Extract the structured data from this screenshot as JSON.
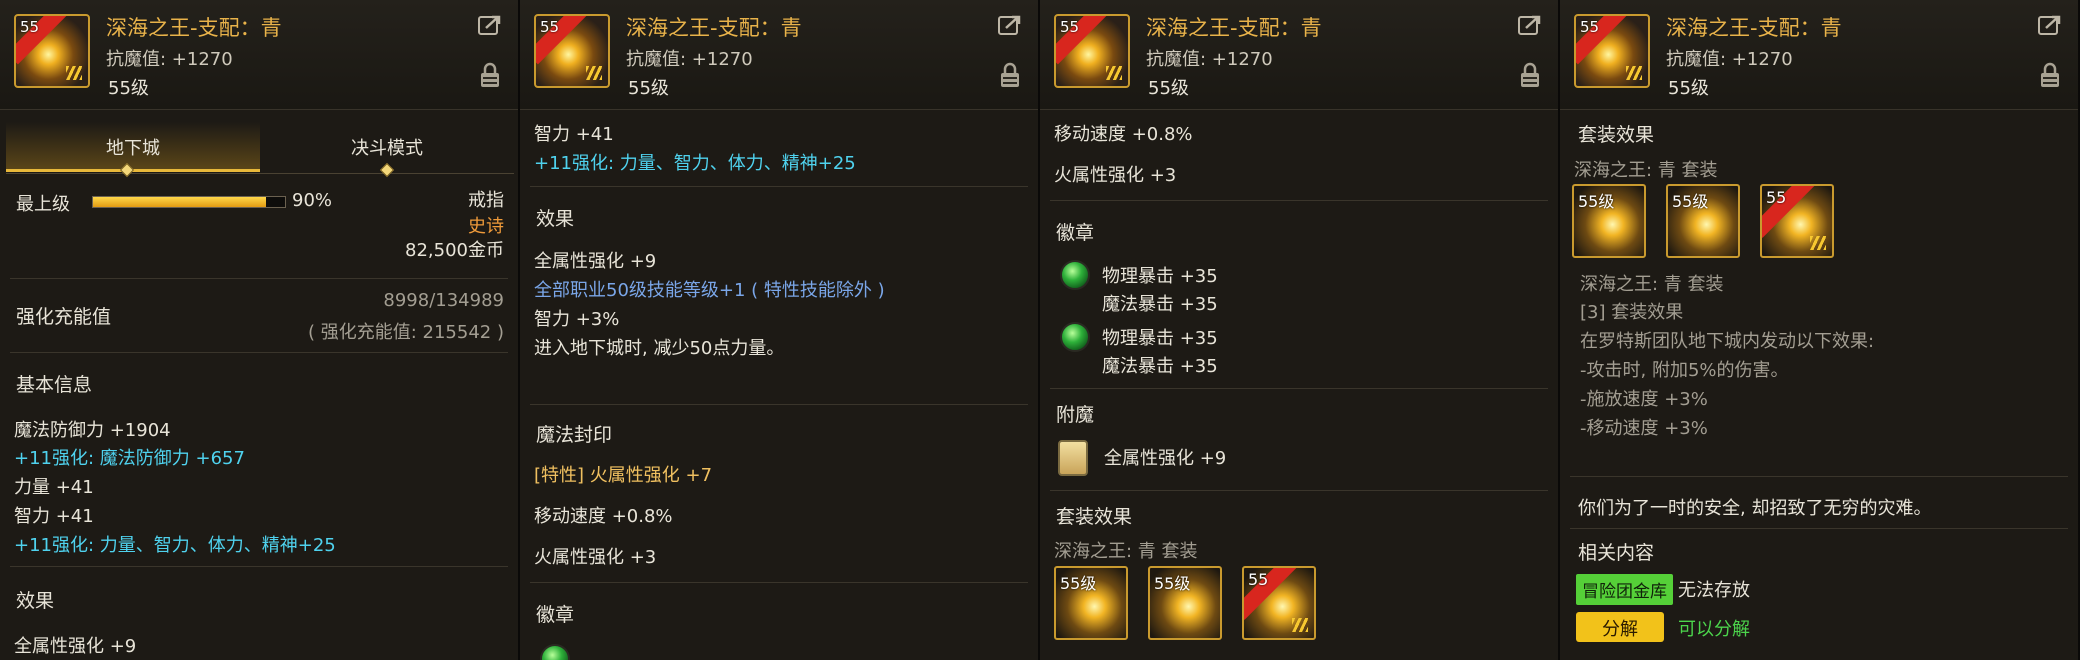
{
  "item": {
    "name": "深海之王-支配：青",
    "stat": "抗魔值: +1270",
    "level": "55级",
    "icon_level": "55"
  },
  "p1": {
    "tabs": [
      "地下城",
      "决斗模式"
    ],
    "grade_label": "最上级",
    "grade_percent": "90%",
    "grade_value": 0.9,
    "slot": "戒指",
    "rarity": "史诗",
    "price": "82,500金币",
    "enhance_label": "强化充能值",
    "enhance_value": "8998/134989",
    "enhance_total": "( 强化充能值: 215542 )",
    "basic_heading": "基本信息",
    "lines": [
      "魔法防御力 +1904",
      "+11强化: 魔法防御力 +657",
      "力量 +41",
      "智力 +41",
      "+11强化: 力量、智力、体力、精神+25"
    ],
    "effect_heading": "效果",
    "effect_cut": "全属性强化 +9"
  },
  "p2": {
    "top_lines": [
      "智力 +41",
      "+11强化: 力量、智力、体力、精神+25"
    ],
    "effect_heading": "效果",
    "effect_lines": [
      "全属性强化 +9",
      "全部职业50级技能等级+1 ( 特性技能除外 )",
      "智力 +3%",
      "进入地下城时, 减少50点力量。"
    ],
    "seal_heading": "魔法封印",
    "seal_lines": [
      "[特性] 火属性强化 +7",
      "移动速度 +0.8%",
      "火属性强化 +3"
    ],
    "emblem_heading": "徽章"
  },
  "p3": {
    "top_lines": [
      "移动速度 +0.8%",
      "火属性强化 +3"
    ],
    "emblem_heading": "徽章",
    "emblems": [
      [
        "物理暴击 +35",
        "魔法暴击 +35"
      ],
      [
        "物理暴击 +35",
        "魔法暴击 +35"
      ]
    ],
    "enchant_heading": "附魔",
    "enchant_line": "全属性强化 +9",
    "set_heading": "套装效果",
    "set_name": "深海之王: 青 套装",
    "set_levels": [
      "55级",
      "55级",
      "55"
    ]
  },
  "p4": {
    "set_heading": "套装效果",
    "set_name": "深海之王: 青 套装",
    "set_levels": [
      "55级",
      "55级",
      "55"
    ],
    "set_name2": "深海之王: 青 套装",
    "set_effect_title": "[3] 套装效果",
    "set_effect_lines": [
      "在罗特斯团队地下城内发动以下效果:",
      "-攻击时, 附加5%的伤害。",
      "-施放速度 +3%",
      "-移动速度 +3%"
    ],
    "flavor": "你们为了一时的安全, 却招致了无穷的灾难。",
    "related_heading": "相关内容",
    "bank_button": "冒险团金库",
    "bank_note": "无法存放",
    "disassemble_button": "分解",
    "disassemble_note": "可以分解"
  },
  "colors": {
    "title": "#e9b34a",
    "cyan": "#4fd2ee",
    "blue": "#7aa6e8",
    "accent_gold": "#e8b83a",
    "green": "#55d038"
  },
  "icons": [
    "item-icon",
    "share-icon",
    "lock-icon",
    "gem-icon",
    "scroll-icon"
  ]
}
